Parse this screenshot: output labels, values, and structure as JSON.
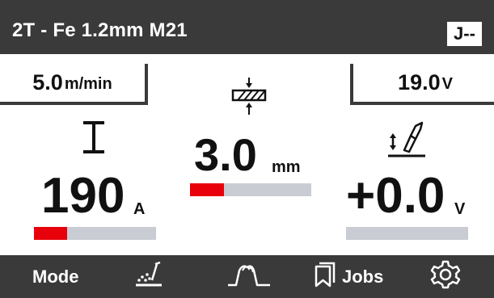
{
  "header": {
    "title": "2T - Fe 1.2mm M21",
    "job_badge": "J--"
  },
  "presets": {
    "wire_speed": {
      "value": "5.0",
      "unit": "m/min"
    },
    "voltage": {
      "value": "19.0",
      "unit": "V"
    }
  },
  "main": {
    "current": {
      "value": "190",
      "unit": "A",
      "bar_fraction": 0.27
    },
    "thickness": {
      "value": "3.0",
      "unit": "mm",
      "bar_fraction": 0.28
    },
    "voltage_correction": {
      "value": "+0.0",
      "unit": "V",
      "bar_fraction": 0.0
    }
  },
  "footer": {
    "mode_label": "Mode",
    "jobs_label": "Jobs"
  },
  "icons": {
    "current": "current-symbol-icon",
    "thickness": "material-thickness-icon",
    "torch": "torch-height-icon",
    "welding": "welding-spark-icon",
    "pulse": "pulse-waveform-icon",
    "jobs": "bookmark-icon",
    "settings": "gear-icon"
  },
  "colors": {
    "header_bg": "#3a3a3a",
    "bar_fill": "#e8000b",
    "bar_track": "#c9ccd3"
  }
}
